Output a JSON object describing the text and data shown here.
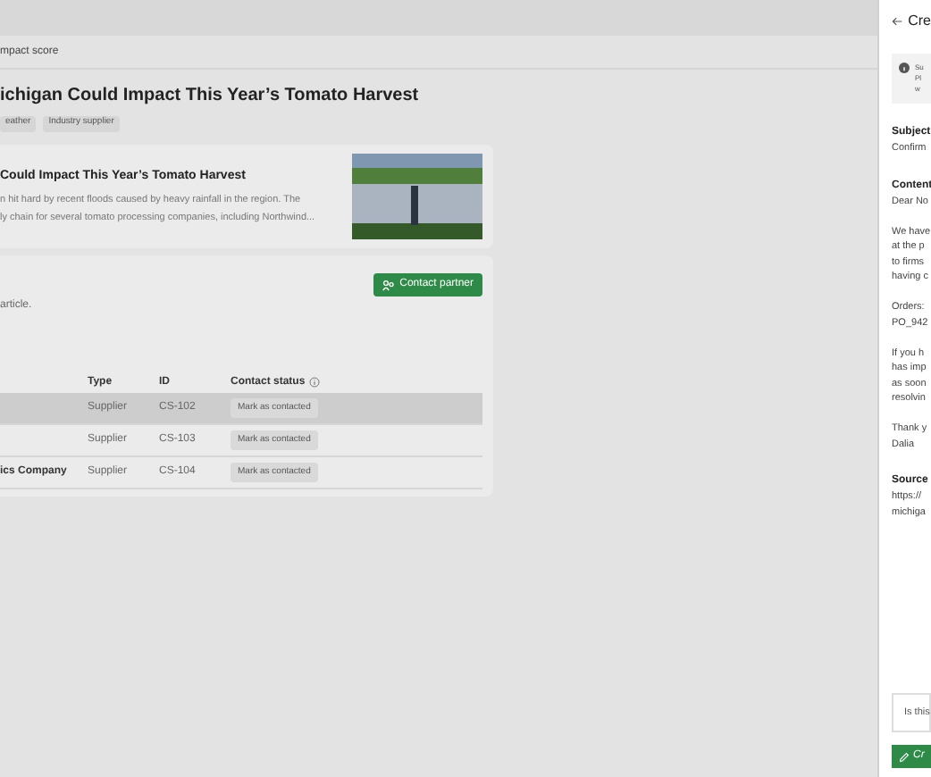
{
  "breadcrumb": "mpact score",
  "article": {
    "title": "ichigan Could Impact This Year’s Tomato Harvest",
    "tags": [
      "eather",
      "Industry supplier"
    ],
    "card": {
      "title": "Could Impact This Year’s Tomato Harvest",
      "lines": [
        "n hit hard by recent floods caused by heavy rainfall in the region. The",
        "ly chain for several tomato processing companies, including Northwind..."
      ]
    }
  },
  "partners": {
    "button": "Contact partner",
    "note": "article.",
    "columns": [
      "Type",
      "ID",
      "Contact status"
    ],
    "rows": [
      {
        "selected": true,
        "type": "Supplier",
        "id": "CS-102",
        "action": "Mark as contacted"
      },
      {
        "selected": false,
        "type": "Supplier",
        "id": "CS-103",
        "action": "Mark as contacted"
      },
      {
        "selected": false,
        "name": "ics Company",
        "type": "Supplier",
        "id": "CS-104",
        "action": "Mark as contacted"
      }
    ]
  },
  "panel": {
    "title": "Cre",
    "info": [
      "Su",
      "Pl",
      "w"
    ],
    "sections": [
      {
        "label": "Subject",
        "lines": [
          "Confirm"
        ]
      },
      {
        "label": "Content",
        "paragraphs": [
          [
            "Dear No"
          ],
          [
            "We have",
            "at the p",
            "to firms",
            "having c"
          ],
          [
            "Orders:",
            "PO_942"
          ],
          [
            "If you h",
            "has imp",
            "as soon",
            "resolvin"
          ],
          [
            "Thank y",
            "Dalia"
          ]
        ]
      },
      {
        "label": "Source",
        "lines": [
          "https://",
          "michiga"
        ]
      }
    ],
    "feedback": "Is this",
    "create": "Cr"
  }
}
